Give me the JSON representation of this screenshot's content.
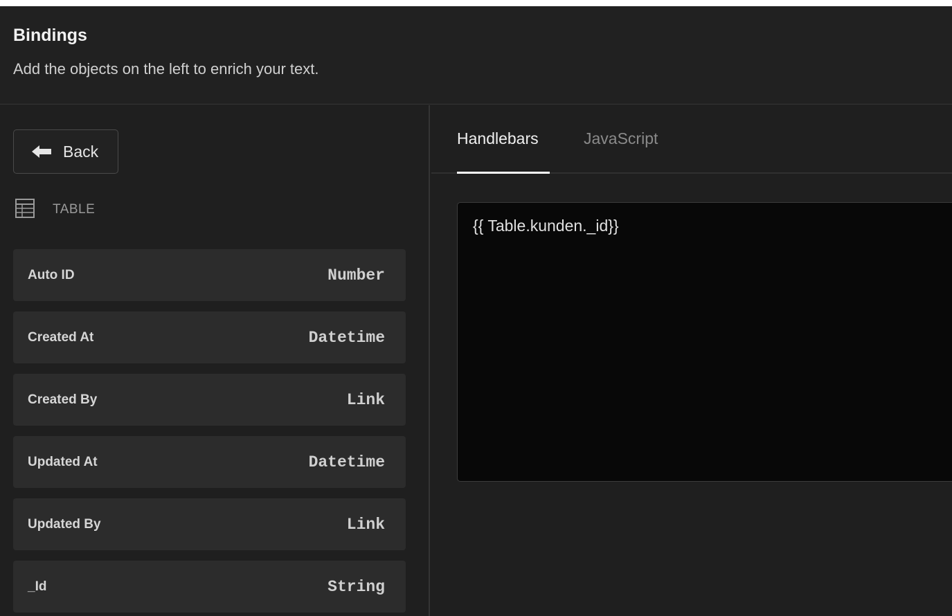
{
  "header": {
    "title": "Bindings",
    "subtitle": "Add the objects on the left to enrich your text."
  },
  "left_panel": {
    "back_label": "Back",
    "section_label": "TABLE",
    "bindings": [
      {
        "name": "Auto ID",
        "type": "Number"
      },
      {
        "name": "Created At",
        "type": "Datetime"
      },
      {
        "name": "Created By",
        "type": "Link"
      },
      {
        "name": "Updated At",
        "type": "Datetime"
      },
      {
        "name": "Updated By",
        "type": "Link"
      },
      {
        "name": "_Id",
        "type": "String"
      }
    ]
  },
  "right_panel": {
    "tabs": [
      {
        "label": "Handlebars",
        "active": true
      },
      {
        "label": "JavaScript",
        "active": false
      }
    ],
    "editor_value": "{{ Table.kunden._id}}"
  },
  "icons": {
    "back": "arrow-left-icon",
    "section": "table-icon"
  },
  "colors": {
    "background": "#1f1f1f",
    "card": "#2c2c2c",
    "editor": "#080808",
    "active_tab_underline": "#ffffff"
  }
}
